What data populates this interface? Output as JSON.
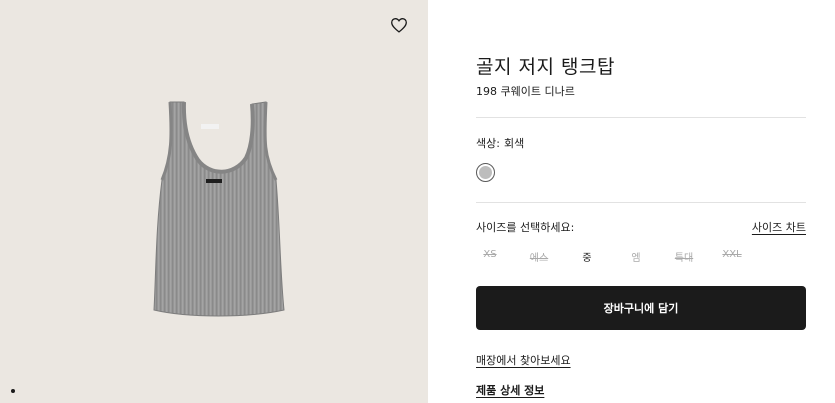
{
  "product": {
    "title": "골지 저지 탱크탑",
    "price": "198 쿠웨이트 디나르",
    "color_label": "색상:",
    "color_value": "회색",
    "swatch_color": "#bdbdbd",
    "size_prompt": "사이즈를 선택하세요:",
    "size_guide": "사이즈 차트",
    "sizes": [
      {
        "label": "XS",
        "state": "out-of-stock"
      },
      {
        "label": "에스",
        "state": "out-of-stock"
      },
      {
        "label": "중",
        "state": "selected"
      },
      {
        "label": "엠",
        "state": "available"
      },
      {
        "label": "특대",
        "state": "out-of-stock"
      },
      {
        "label": "XXL",
        "state": "out-of-stock"
      }
    ],
    "add_to_cart": "장바구니에 담기",
    "find_in_store": "매장에서 찾아보세요",
    "product_details": "제품 상세 정보"
  },
  "gallery": {
    "wishlist_icon": "heart-icon",
    "image_background": "#ebe7e1",
    "garment_color": "#999999"
  }
}
